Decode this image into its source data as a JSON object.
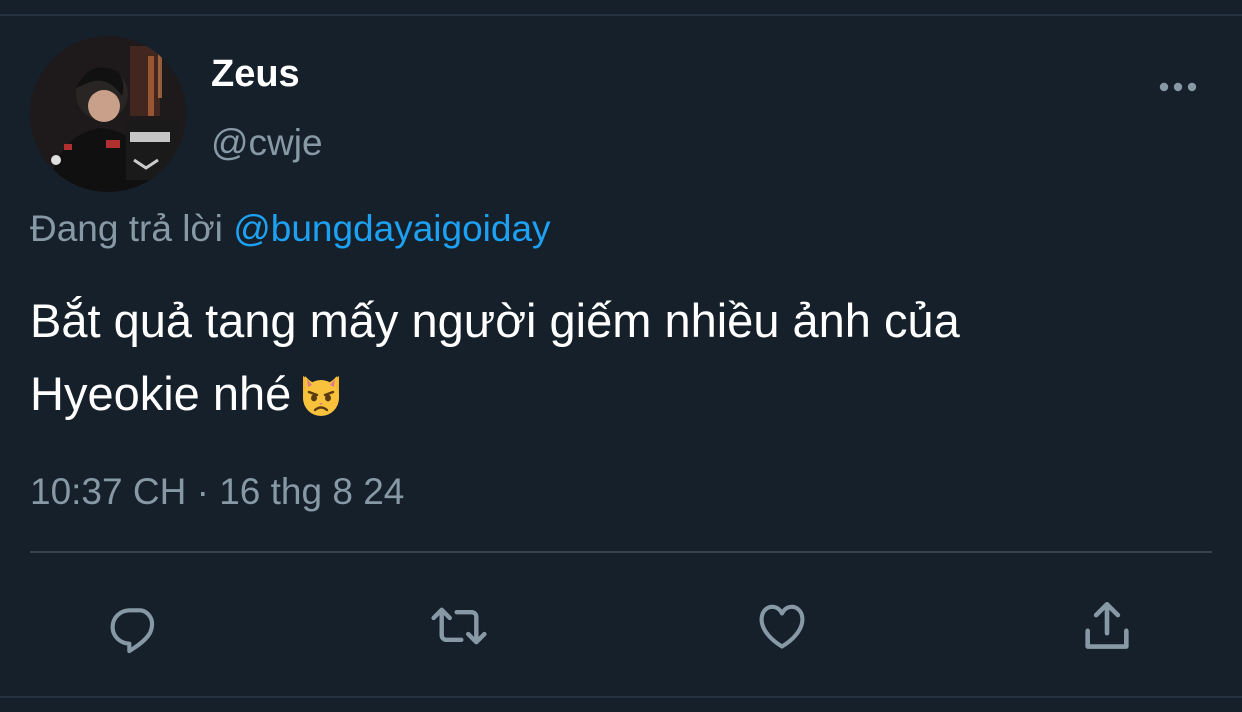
{
  "tweet": {
    "display_name": "Zeus",
    "handle": "@cwje",
    "reply_prefix": "Đang trả lời",
    "reply_to": "@bungdayaigoiday",
    "text_line1": "Bắt quả tang mấy người giếm nhiều ảnh của",
    "text_line2": "Hyeokie nhé",
    "emoji": "pouting-cat-emoji",
    "timestamp": "10:37 CH · 16 thg 8 24"
  },
  "icons": {
    "more": "more-horizontal-icon",
    "reply": "reply-icon",
    "retweet": "retweet-icon",
    "like": "heart-icon",
    "share": "share-icon"
  },
  "colors": {
    "background": "#15202b",
    "primary_text": "#ffffff",
    "secondary_text": "#8899a6",
    "accent": "#1da1f2",
    "divider": "#38444d"
  }
}
